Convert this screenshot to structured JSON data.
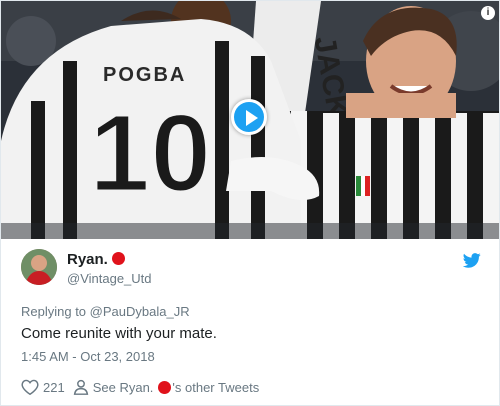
{
  "media": {
    "jersey_name": "POGBA",
    "jersey_number": "10",
    "banner_text": "JACK",
    "play_icon": "play-icon",
    "info_label": "i"
  },
  "tweet": {
    "display_name": "Ryan.",
    "handle": "@Vintage_Utd",
    "replying_label": "Replying to",
    "replying_to": "@PauDybala_JR",
    "text": "Come reunite with your mate.",
    "timestamp": "1:45 AM - Oct 23, 2018",
    "likes": "221",
    "see_prefix": "See Ryan.",
    "see_suffix": "'s other Tweets",
    "accent": "#1da1f2",
    "red_dot": "#e0121b"
  }
}
